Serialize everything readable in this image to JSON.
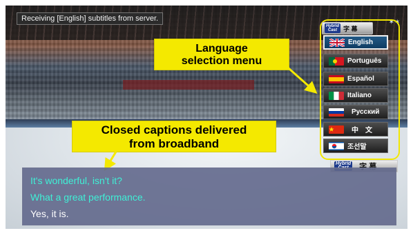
{
  "status": {
    "text": "Receiving [English] subtitles from server."
  },
  "hybridcast_badge": {
    "logo_line1": "Hybrid",
    "logo_line2": "Cast",
    "label": "字 幕"
  },
  "language_menu": {
    "items": [
      {
        "label": "English",
        "flag": "uk-flag-icon",
        "selected": true
      },
      {
        "label": "Português",
        "flag": "portugal-flag-icon",
        "selected": false
      },
      {
        "label": "Español",
        "flag": "spain-flag-icon",
        "selected": false
      },
      {
        "label": "Italiano",
        "flag": "italy-flag-icon",
        "selected": false
      },
      {
        "label": "Русский",
        "flag": "russia-flag-icon",
        "selected": false
      },
      {
        "label": "中　文",
        "flag": "china-flag-icon",
        "selected": false
      },
      {
        "label": "조선말",
        "flag": "korea-flag-icon",
        "selected": false
      }
    ]
  },
  "callouts": {
    "language": {
      "line1": "Language",
      "line2": "selection menu"
    },
    "captions": {
      "line1": "Closed captions delivered",
      "line2": "from broadband"
    }
  },
  "captions": {
    "lines": [
      {
        "text": "It's wonderful, isn't it?",
        "color": "#3ff0d6"
      },
      {
        "text": "What a great performance.",
        "color": "#3ff0d6"
      },
      {
        "text": "Yes, it is.",
        "color": "#ffffff"
      }
    ]
  },
  "colors": {
    "highlight": "#f4e900",
    "selected_item": "#1a4c78",
    "caption_bg": "#62688c"
  }
}
